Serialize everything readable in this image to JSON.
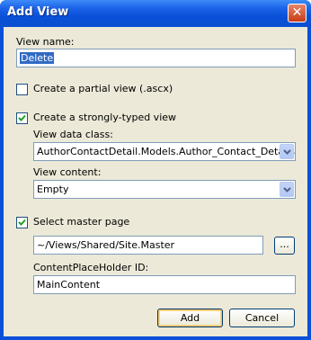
{
  "window": {
    "title": "Add View"
  },
  "view_name": {
    "label": "View name:",
    "value": "Delete"
  },
  "partial": {
    "label": "Create a partial view (.ascx)",
    "checked": false
  },
  "strongly": {
    "label": "Create a strongly-typed view",
    "checked": true
  },
  "data_class": {
    "label": "View data class:",
    "value": "AuthorContactDetail.Models.Author_Contact_Details"
  },
  "content": {
    "label": "View content:",
    "value": "Empty"
  },
  "master": {
    "label": "Select master page",
    "checked": true,
    "value": "~/Views/Shared/Site.Master",
    "browse_label": "..."
  },
  "placeholder": {
    "label": "ContentPlaceHolder ID:",
    "value": "MainContent"
  },
  "buttons": {
    "add": "Add",
    "cancel": "Cancel"
  },
  "icons": {
    "close": "close-icon",
    "check": "checkmark-icon",
    "dropdown": "chevron-down-icon"
  }
}
